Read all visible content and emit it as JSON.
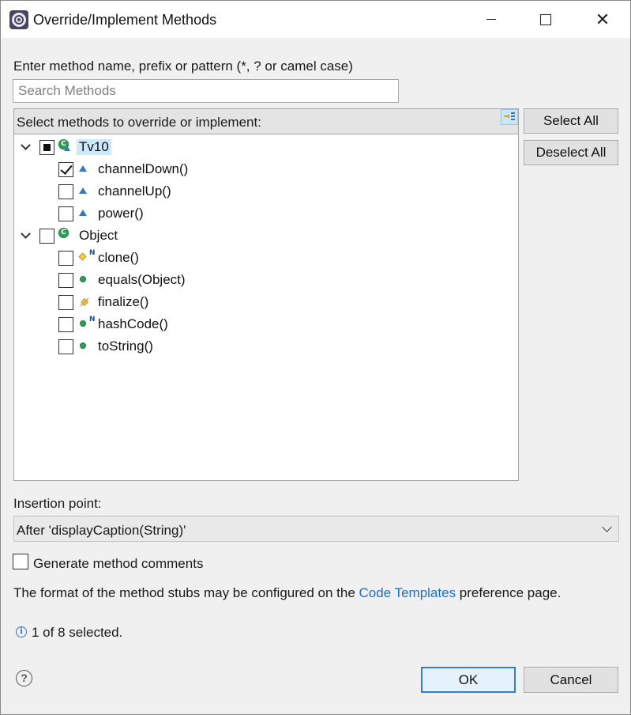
{
  "window": {
    "title": "Override/Implement Methods",
    "icons": {
      "app": "eclipse-app-icon",
      "minimize": "minimize-icon",
      "maximize": "maximize-icon",
      "close": "close-icon"
    }
  },
  "search": {
    "prompt": "Enter method name, prefix or pattern (*, ? or camel case)",
    "placeholder": "Search Methods",
    "value": ""
  },
  "methods_list": {
    "header": "Select methods to override or implement:",
    "sort_icon": "sort-by-type-icon",
    "groups": [
      {
        "label": "Tv10",
        "expanded": true,
        "check_state": "partial",
        "selected": true,
        "icon": "class-with-warning-icon",
        "items": [
          {
            "label": "channelDown()",
            "checked": true,
            "icon": "protected-method-icon"
          },
          {
            "label": "channelUp()",
            "checked": false,
            "icon": "protected-method-icon"
          },
          {
            "label": "power()",
            "checked": false,
            "icon": "protected-method-icon"
          }
        ]
      },
      {
        "label": "Object",
        "expanded": true,
        "check_state": "unchecked",
        "selected": false,
        "icon": "class-icon",
        "items": [
          {
            "label": "clone()",
            "checked": false,
            "icon": "protected-native-method-icon",
            "native": "N"
          },
          {
            "label": "equals(Object)",
            "checked": false,
            "icon": "public-method-icon"
          },
          {
            "label": "finalize()",
            "checked": false,
            "icon": "deprecated-protected-method-icon"
          },
          {
            "label": "hashCode()",
            "checked": false,
            "icon": "public-native-method-icon",
            "native": "N"
          },
          {
            "label": "toString()",
            "checked": false,
            "icon": "public-method-icon"
          }
        ]
      }
    ]
  },
  "side_buttons": {
    "select_all": "Select All",
    "deselect_all": "Deselect All"
  },
  "insertion": {
    "label": "Insertion point:",
    "selected": "After 'displayCaption(String)'"
  },
  "options": {
    "generate_comments_label": "Generate method comments",
    "generate_comments_checked": false
  },
  "info": {
    "before": "The format of the method stubs may be configured on the ",
    "link": "Code Templates",
    "after": " preference page."
  },
  "status": {
    "text": "1 of 8 selected.",
    "icon": "info-icon"
  },
  "footer": {
    "help_icon": "help-icon",
    "ok": "OK",
    "cancel": "Cancel"
  },
  "colors": {
    "accent": "#2f7fd6",
    "link": "#1f6fc5",
    "selection": "#cce8ff",
    "class_green": "#2f9e58",
    "method_blue": "#3a78b5"
  }
}
